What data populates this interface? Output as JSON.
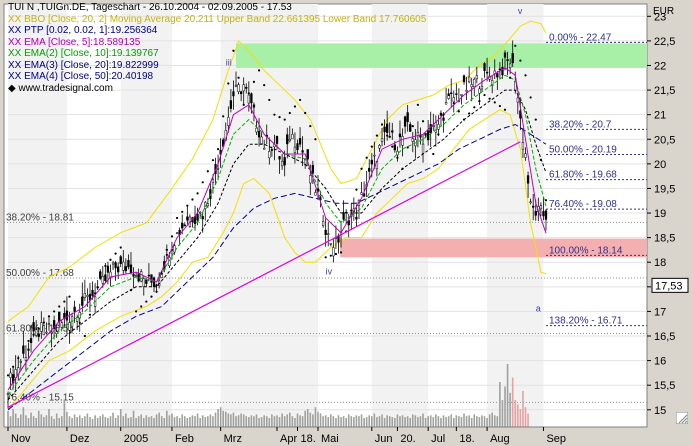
{
  "legend": {
    "title": "TUI N ,TUIGn.DE, Tageschart - 26.10.2004 - 02.09.2005 - 17.53",
    "bollinger": "XX BBO [Close, 20, 2] Moving Average 20.211 Upper Band 22.661395 Lower Band 17.760605",
    "ptp": "XX PTP [0.02, 0.02, 1]:19.256364",
    "ema1": "XX EMA [Close, 5]:18.589135",
    "ema2": "XX EMA(2) [Close, 10]:19.139767",
    "ema3": "XX EMA(3) [Close, 20]:19.822999",
    "ema4": "XX EMA(4) [Close, 50]:20.40198",
    "source": "www.tradesignal.com"
  },
  "colors": {
    "background": "#d9d5cc",
    "plot": "#ffffff",
    "shade": "#f2f2f2",
    "bollinger": "#f2e000",
    "ema5": "#c000c0",
    "ema10": "#00b000",
    "ema20": "#000000",
    "ema50": "#000090",
    "psar": "#000000",
    "trendline": "#e000e0",
    "fib_zone_green": "#a8f0a8",
    "fib_zone_red": "#f4b0b0",
    "fib_text": "#303090",
    "volume": "#a0a0a0",
    "volume_hi": "#e8a0a0"
  },
  "icons": {
    "resize_grip": "resize-grip-icon"
  },
  "chart_data": {
    "type": "line",
    "subtype": "candlestick stock chart with indicators",
    "unit": "EUR",
    "ylim": [
      14.65,
      23.25
    ],
    "yticks": [
      15,
      15.5,
      16,
      16.5,
      17,
      17.5,
      18,
      18.5,
      19,
      19.5,
      20,
      20.5,
      21,
      21.5,
      22,
      22.5,
      23
    ],
    "y_tick_labels": [
      "15",
      "15,5",
      "16",
      "16,5",
      "17",
      "17,5",
      "18",
      "18,5",
      "19",
      "19,5",
      "20",
      "20,5",
      "21",
      "21,5",
      "22",
      "22,5",
      "23"
    ],
    "last_price": 17.53,
    "last_price_label": "17,53",
    "x_labels": [
      "Nov",
      "Dez",
      "2005",
      "Feb",
      "Mrz",
      "Apr",
      "18.",
      "Mai",
      "Jun",
      "20.",
      "Jul",
      "18.",
      "Aug",
      "Sep"
    ],
    "x_label_bars": [
      0,
      23,
      44,
      64,
      83,
      105,
      113,
      121,
      142,
      152,
      164,
      175,
      187,
      209
    ],
    "n_bars": 211,
    "close_path": [
      [
        0,
        15.5
      ],
      [
        6,
        16.1
      ],
      [
        12,
        16.6
      ],
      [
        18,
        16.6
      ],
      [
        24,
        16.9
      ],
      [
        30,
        17.2
      ],
      [
        36,
        17.5
      ],
      [
        42,
        17.9
      ],
      [
        48,
        17.9
      ],
      [
        54,
        17.6
      ],
      [
        58,
        17.6
      ],
      [
        64,
        18.4
      ],
      [
        70,
        18.9
      ],
      [
        76,
        19.0
      ],
      [
        80,
        19.6
      ],
      [
        84,
        20.5
      ],
      [
        88,
        21.4
      ],
      [
        92,
        21.6
      ],
      [
        96,
        21.0
      ],
      [
        100,
        20.4
      ],
      [
        104,
        20.4
      ],
      [
        108,
        19.9
      ],
      [
        110,
        20.6
      ],
      [
        114,
        20.4
      ],
      [
        118,
        19.8
      ],
      [
        122,
        19.2
      ],
      [
        125,
        18.5
      ],
      [
        128,
        18.35
      ],
      [
        132,
        18.9
      ],
      [
        136,
        19.0
      ],
      [
        140,
        19.6
      ],
      [
        144,
        20.2
      ],
      [
        148,
        20.6
      ],
      [
        152,
        20.4
      ],
      [
        156,
        20.7
      ],
      [
        160,
        20.5
      ],
      [
        164,
        20.6
      ],
      [
        168,
        20.8
      ],
      [
        172,
        21.3
      ],
      [
        176,
        21.4
      ],
      [
        180,
        21.6
      ],
      [
        184,
        21.7
      ],
      [
        188,
        21.8
      ],
      [
        192,
        21.9
      ],
      [
        196,
        22.1
      ],
      [
        198,
        21.8
      ],
      [
        200,
        20.9
      ],
      [
        202,
        20.2
      ],
      [
        204,
        19.1
      ],
      [
        207,
        19.0
      ],
      [
        210,
        18.95
      ]
    ],
    "upper_band_path": [
      [
        0,
        16.8
      ],
      [
        8,
        17.1
      ],
      [
        16,
        17.7
      ],
      [
        24,
        17.9
      ],
      [
        34,
        18.3
      ],
      [
        44,
        18.6
      ],
      [
        54,
        18.8
      ],
      [
        64,
        19.5
      ],
      [
        72,
        20.1
      ],
      [
        80,
        20.9
      ],
      [
        86,
        21.9
      ],
      [
        90,
        22.5
      ],
      [
        94,
        22.3
      ],
      [
        100,
        21.9
      ],
      [
        106,
        21.6
      ],
      [
        112,
        21.3
      ],
      [
        118,
        20.9
      ],
      [
        122,
        20.4
      ],
      [
        126,
        19.9
      ],
      [
        130,
        19.6
      ],
      [
        136,
        19.7
      ],
      [
        142,
        20.3
      ],
      [
        148,
        20.9
      ],
      [
        154,
        21.2
      ],
      [
        160,
        21.3
      ],
      [
        166,
        21.4
      ],
      [
        172,
        21.6
      ],
      [
        178,
        21.7
      ],
      [
        184,
        22.0
      ],
      [
        190,
        22.2
      ],
      [
        196,
        22.55
      ],
      [
        200,
        22.8
      ],
      [
        204,
        22.9
      ],
      [
        208,
        22.85
      ],
      [
        210,
        22.66
      ]
    ],
    "lower_band_path": [
      [
        0,
        15.0
      ],
      [
        8,
        15.5
      ],
      [
        16,
        16.0
      ],
      [
        24,
        16.2
      ],
      [
        34,
        16.6
      ],
      [
        44,
        16.9
      ],
      [
        54,
        17.1
      ],
      [
        60,
        17.3
      ],
      [
        66,
        17.6
      ],
      [
        72,
        18.0
      ],
      [
        78,
        18.1
      ],
      [
        84,
        18.6
      ],
      [
        88,
        19.0
      ],
      [
        92,
        19.6
      ],
      [
        96,
        19.7
      ],
      [
        102,
        19.4
      ],
      [
        108,
        18.5
      ],
      [
        112,
        18.2
      ],
      [
        116,
        18.0
      ],
      [
        120,
        18.0
      ],
      [
        126,
        18.3
      ],
      [
        132,
        18.5
      ],
      [
        138,
        18.5
      ],
      [
        144,
        19.0
      ],
      [
        150,
        19.3
      ],
      [
        156,
        19.6
      ],
      [
        162,
        19.7
      ],
      [
        168,
        19.9
      ],
      [
        174,
        20.3
      ],
      [
        180,
        20.7
      ],
      [
        186,
        20.9
      ],
      [
        192,
        21.1
      ],
      [
        196,
        21.0
      ],
      [
        200,
        20.3
      ],
      [
        204,
        18.8
      ],
      [
        208,
        17.8
      ],
      [
        210,
        17.76
      ]
    ],
    "ema5_path": [
      [
        0,
        15.4
      ],
      [
        10,
        16.2
      ],
      [
        20,
        16.8
      ],
      [
        30,
        17.1
      ],
      [
        40,
        17.7
      ],
      [
        50,
        17.8
      ],
      [
        58,
        17.6
      ],
      [
        66,
        18.5
      ],
      [
        74,
        19.0
      ],
      [
        82,
        20.0
      ],
      [
        88,
        21.0
      ],
      [
        94,
        21.2
      ],
      [
        100,
        20.6
      ],
      [
        108,
        20.2
      ],
      [
        116,
        20.2
      ],
      [
        124,
        18.9
      ],
      [
        130,
        18.6
      ],
      [
        138,
        19.3
      ],
      [
        146,
        20.3
      ],
      [
        154,
        20.5
      ],
      [
        162,
        20.6
      ],
      [
        170,
        21.0
      ],
      [
        178,
        21.4
      ],
      [
        186,
        21.7
      ],
      [
        194,
        21.95
      ],
      [
        198,
        21.8
      ],
      [
        202,
        20.5
      ],
      [
        206,
        19.2
      ],
      [
        210,
        18.59
      ]
    ],
    "ema10_path": [
      [
        0,
        15.3
      ],
      [
        10,
        16.0
      ],
      [
        20,
        16.6
      ],
      [
        30,
        17.0
      ],
      [
        40,
        17.5
      ],
      [
        50,
        17.7
      ],
      [
        58,
        17.6
      ],
      [
        66,
        18.3
      ],
      [
        74,
        18.8
      ],
      [
        82,
        19.7
      ],
      [
        88,
        20.6
      ],
      [
        94,
        20.9
      ],
      [
        100,
        20.6
      ],
      [
        108,
        20.2
      ],
      [
        116,
        20.1
      ],
      [
        124,
        19.2
      ],
      [
        130,
        18.8
      ],
      [
        138,
        19.1
      ],
      [
        146,
        19.9
      ],
      [
        154,
        20.3
      ],
      [
        162,
        20.5
      ],
      [
        170,
        20.8
      ],
      [
        178,
        21.2
      ],
      [
        186,
        21.5
      ],
      [
        194,
        21.8
      ],
      [
        198,
        21.7
      ],
      [
        202,
        21.0
      ],
      [
        206,
        19.9
      ],
      [
        210,
        19.14
      ]
    ],
    "ema20_path": [
      [
        0,
        15.2
      ],
      [
        10,
        15.8
      ],
      [
        20,
        16.4
      ],
      [
        30,
        16.8
      ],
      [
        40,
        17.2
      ],
      [
        50,
        17.5
      ],
      [
        58,
        17.5
      ],
      [
        66,
        18.0
      ],
      [
        74,
        18.5
      ],
      [
        82,
        19.2
      ],
      [
        88,
        20.0
      ],
      [
        94,
        20.4
      ],
      [
        100,
        20.4
      ],
      [
        108,
        20.2
      ],
      [
        116,
        20.0
      ],
      [
        124,
        19.5
      ],
      [
        130,
        19.0
      ],
      [
        138,
        19.0
      ],
      [
        146,
        19.5
      ],
      [
        154,
        19.9
      ],
      [
        162,
        20.2
      ],
      [
        170,
        20.5
      ],
      [
        178,
        20.9
      ],
      [
        186,
        21.2
      ],
      [
        194,
        21.5
      ],
      [
        198,
        21.5
      ],
      [
        202,
        21.1
      ],
      [
        206,
        20.4
      ],
      [
        210,
        19.82
      ]
    ],
    "ema50_path": [
      [
        0,
        15.0
      ],
      [
        10,
        15.4
      ],
      [
        20,
        15.8
      ],
      [
        30,
        16.2
      ],
      [
        40,
        16.6
      ],
      [
        50,
        16.9
      ],
      [
        60,
        17.1
      ],
      [
        70,
        17.6
      ],
      [
        80,
        18.1
      ],
      [
        88,
        18.7
      ],
      [
        96,
        19.1
      ],
      [
        104,
        19.3
      ],
      [
        112,
        19.4
      ],
      [
        120,
        19.3
      ],
      [
        128,
        19.2
      ],
      [
        136,
        19.2
      ],
      [
        144,
        19.4
      ],
      [
        152,
        19.6
      ],
      [
        160,
        19.8
      ],
      [
        168,
        20.0
      ],
      [
        176,
        20.3
      ],
      [
        184,
        20.5
      ],
      [
        192,
        20.7
      ],
      [
        198,
        20.8
      ],
      [
        204,
        20.6
      ],
      [
        210,
        20.4
      ]
    ],
    "psar_path": [
      [
        0,
        15.7
      ],
      [
        8,
        16.4
      ],
      [
        16,
        16.9
      ],
      [
        24,
        17.3
      ],
      [
        30,
        16.5
      ],
      [
        36,
        17.8
      ],
      [
        44,
        18.3
      ],
      [
        50,
        17.0
      ],
      [
        58,
        17.4
      ],
      [
        66,
        18.9
      ],
      [
        74,
        19.4
      ],
      [
        82,
        20.3
      ],
      [
        88,
        22.3
      ],
      [
        92,
        21.2
      ],
      [
        98,
        21.9
      ],
      [
        104,
        21.0
      ],
      [
        108,
        20.9
      ],
      [
        114,
        21.3
      ],
      [
        120,
        20.5
      ],
      [
        124,
        18.1
      ],
      [
        130,
        18.2
      ],
      [
        138,
        19.9
      ],
      [
        146,
        20.8
      ],
      [
        154,
        19.9
      ],
      [
        160,
        21.2
      ],
      [
        166,
        20.2
      ],
      [
        172,
        21.4
      ],
      [
        178,
        20.9
      ],
      [
        186,
        21.4
      ],
      [
        194,
        21.1
      ],
      [
        198,
        22.4
      ],
      [
        202,
        21.8
      ],
      [
        206,
        20.9
      ],
      [
        210,
        19.26
      ]
    ],
    "trendline": [
      [
        0,
        15.05
      ],
      [
        200,
        20.45
      ]
    ],
    "volume": [
      0.18,
      0.12,
      0.2,
      0.15,
      0.1,
      0.14,
      0.22,
      0.13,
      0.1,
      0.16,
      0.12,
      0.1,
      0.18,
      0.14,
      0.11,
      0.13,
      0.2,
      0.12,
      0.09,
      0.15,
      0.1,
      0.12,
      0.3,
      0.17,
      0.12,
      0.1,
      0.14,
      0.11,
      0.13,
      0.1,
      0.12,
      0.15,
      0.11,
      0.09,
      0.13,
      0.1,
      0.12,
      0.14,
      0.11,
      0.1,
      0.12,
      0.16,
      0.1,
      0.13,
      0.2,
      0.12,
      0.15,
      0.1,
      0.11,
      0.18,
      0.1,
      0.12,
      0.14,
      0.1,
      0.13,
      0.11,
      0.12,
      0.1,
      0.14,
      0.16,
      0.12,
      0.1,
      0.18,
      0.13,
      0.15,
      0.11,
      0.12,
      0.1,
      0.14,
      0.12,
      0.1,
      0.11,
      0.13,
      0.12,
      0.15,
      0.1,
      0.13,
      0.11,
      0.12,
      0.14,
      0.12,
      0.16,
      0.2,
      0.22,
      0.18,
      0.17,
      0.15,
      0.14,
      0.16,
      0.12,
      0.13,
      0.15,
      0.14,
      0.12,
      0.11,
      0.13,
      0.12,
      0.14,
      0.1,
      0.11,
      0.13,
      0.12,
      0.1,
      0.14,
      0.12,
      0.13,
      0.11,
      0.15,
      0.12,
      0.14,
      0.16,
      0.12,
      0.1,
      0.15,
      0.13,
      0.12,
      0.18,
      0.2,
      0.16,
      0.14,
      0.22,
      0.17,
      0.15,
      0.12,
      0.13,
      0.11,
      0.14,
      0.12,
      0.1,
      0.13,
      0.11,
      0.12,
      0.1,
      0.14,
      0.12,
      0.11,
      0.13,
      0.12,
      0.14,
      0.1,
      0.11,
      0.13,
      0.12,
      0.15,
      0.11,
      0.12,
      0.14,
      0.1,
      0.13,
      0.12,
      0.11,
      0.1,
      0.14,
      0.12,
      0.13,
      0.11,
      0.12,
      0.1,
      0.14,
      0.13,
      0.11,
      0.12,
      0.15,
      0.1,
      0.12,
      0.13,
      0.11,
      0.14,
      0.12,
      0.1,
      0.13,
      0.11,
      0.12,
      0.14,
      0.1,
      0.13,
      0.12,
      0.11,
      0.15,
      0.12,
      0.13,
      0.1,
      0.14,
      0.12,
      0.11,
      0.13,
      0.12,
      0.1,
      0.14,
      0.16,
      0.13,
      0.12,
      0.5,
      0.3,
      0.45,
      0.7,
      0.38,
      0.55,
      0.3,
      0.25,
      0.2,
      0.4,
      0.22,
      0.15
    ],
    "volume_hi_from": 197,
    "fib_levels": [
      {
        "label": "0.00% - 22.47",
        "value": 22.47
      },
      {
        "label": "38.20% - 20.7",
        "value": 20.7
      },
      {
        "label": "50.00% - 20.19",
        "value": 20.19
      },
      {
        "label": "61.80% - 19.68",
        "value": 19.68
      },
      {
        "label": "76.40% - 19.08",
        "value": 19.08
      },
      {
        "label": "100.00% - 18.14",
        "value": 18.14
      },
      {
        "label": "138.20% - 16.71",
        "value": 16.71
      }
    ],
    "fib_levels_left": [
      {
        "label": "38.20% - 18.81",
        "value": 18.81
      },
      {
        "label": "50.00% - 17.68",
        "value": 17.68
      },
      {
        "label": "61.80% - 16.55",
        "value": 16.55
      },
      {
        "label": "76.40% - 15.15",
        "value": 15.15
      }
    ],
    "zones": [
      {
        "from": 21.95,
        "to": 22.45,
        "color": "green"
      },
      {
        "from": 18.1,
        "to": 18.48,
        "color": "red"
      }
    ],
    "wave_labels": [
      {
        "text": "iii",
        "bar": 85,
        "value": 22.0
      },
      {
        "text": "iv",
        "bar": 124,
        "value": 17.75
      },
      {
        "text": "v",
        "bar": 199,
        "value": 23.05
      },
      {
        "text": "a",
        "bar": 206,
        "value": 17.0
      }
    ],
    "grid": true,
    "legend_position": "top-left"
  }
}
